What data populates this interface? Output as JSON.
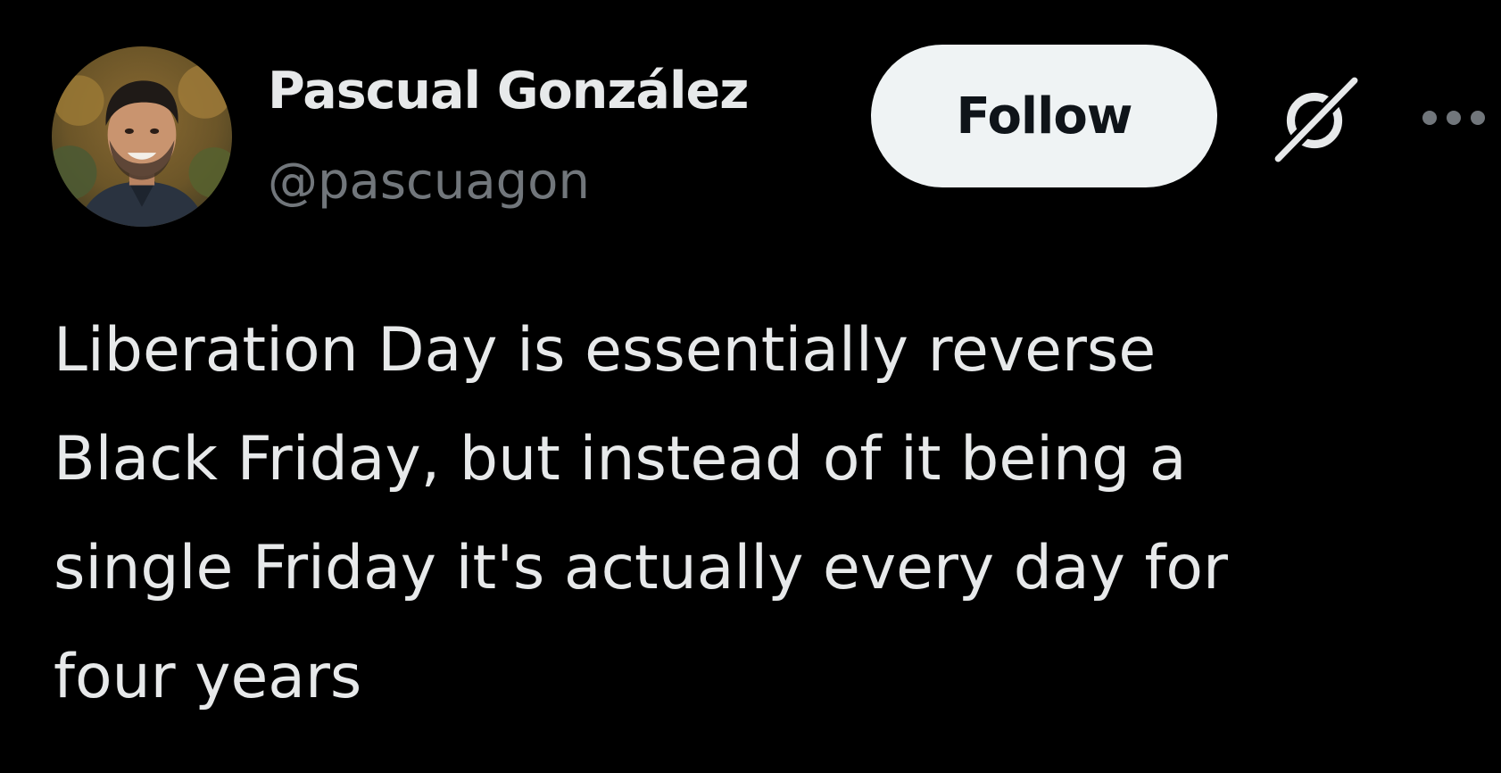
{
  "author": {
    "display_name": "Pascual González",
    "handle": "@pascuagon",
    "avatar_icon": "profile-photo"
  },
  "actions": {
    "follow_label": "Follow",
    "grok_icon": "grok-icon",
    "more_icon": "more-options-icon"
  },
  "tweet": {
    "text": "Liberation Day is essentially reverse\nBlack Friday, but instead of it being a\nsingle Friday it's actually every day for\nfour years"
  },
  "colors": {
    "background": "#000000",
    "primary_text": "#e7e9ea",
    "secondary_text": "#71767b",
    "follow_button_bg": "#eff3f4",
    "follow_button_text": "#0f1419"
  }
}
